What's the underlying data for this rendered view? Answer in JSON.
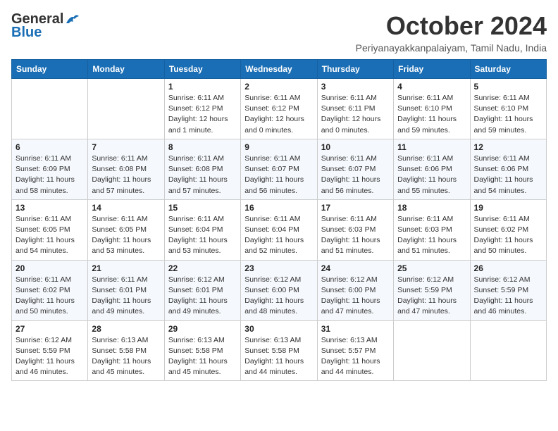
{
  "logo": {
    "line1": "General",
    "line2": "Blue"
  },
  "title": "October 2024",
  "location": "Periyanayakkanpalaiyam, Tamil Nadu, India",
  "days_of_week": [
    "Sunday",
    "Monday",
    "Tuesday",
    "Wednesday",
    "Thursday",
    "Friday",
    "Saturday"
  ],
  "weeks": [
    [
      {
        "day": "",
        "info": ""
      },
      {
        "day": "",
        "info": ""
      },
      {
        "day": "1",
        "info": "Sunrise: 6:11 AM\nSunset: 6:12 PM\nDaylight: 12 hours\nand 1 minute."
      },
      {
        "day": "2",
        "info": "Sunrise: 6:11 AM\nSunset: 6:12 PM\nDaylight: 12 hours\nand 0 minutes."
      },
      {
        "day": "3",
        "info": "Sunrise: 6:11 AM\nSunset: 6:11 PM\nDaylight: 12 hours\nand 0 minutes."
      },
      {
        "day": "4",
        "info": "Sunrise: 6:11 AM\nSunset: 6:10 PM\nDaylight: 11 hours\nand 59 minutes."
      },
      {
        "day": "5",
        "info": "Sunrise: 6:11 AM\nSunset: 6:10 PM\nDaylight: 11 hours\nand 59 minutes."
      }
    ],
    [
      {
        "day": "6",
        "info": "Sunrise: 6:11 AM\nSunset: 6:09 PM\nDaylight: 11 hours\nand 58 minutes."
      },
      {
        "day": "7",
        "info": "Sunrise: 6:11 AM\nSunset: 6:08 PM\nDaylight: 11 hours\nand 57 minutes."
      },
      {
        "day": "8",
        "info": "Sunrise: 6:11 AM\nSunset: 6:08 PM\nDaylight: 11 hours\nand 57 minutes."
      },
      {
        "day": "9",
        "info": "Sunrise: 6:11 AM\nSunset: 6:07 PM\nDaylight: 11 hours\nand 56 minutes."
      },
      {
        "day": "10",
        "info": "Sunrise: 6:11 AM\nSunset: 6:07 PM\nDaylight: 11 hours\nand 56 minutes."
      },
      {
        "day": "11",
        "info": "Sunrise: 6:11 AM\nSunset: 6:06 PM\nDaylight: 11 hours\nand 55 minutes."
      },
      {
        "day": "12",
        "info": "Sunrise: 6:11 AM\nSunset: 6:06 PM\nDaylight: 11 hours\nand 54 minutes."
      }
    ],
    [
      {
        "day": "13",
        "info": "Sunrise: 6:11 AM\nSunset: 6:05 PM\nDaylight: 11 hours\nand 54 minutes."
      },
      {
        "day": "14",
        "info": "Sunrise: 6:11 AM\nSunset: 6:05 PM\nDaylight: 11 hours\nand 53 minutes."
      },
      {
        "day": "15",
        "info": "Sunrise: 6:11 AM\nSunset: 6:04 PM\nDaylight: 11 hours\nand 53 minutes."
      },
      {
        "day": "16",
        "info": "Sunrise: 6:11 AM\nSunset: 6:04 PM\nDaylight: 11 hours\nand 52 minutes."
      },
      {
        "day": "17",
        "info": "Sunrise: 6:11 AM\nSunset: 6:03 PM\nDaylight: 11 hours\nand 51 minutes."
      },
      {
        "day": "18",
        "info": "Sunrise: 6:11 AM\nSunset: 6:03 PM\nDaylight: 11 hours\nand 51 minutes."
      },
      {
        "day": "19",
        "info": "Sunrise: 6:11 AM\nSunset: 6:02 PM\nDaylight: 11 hours\nand 50 minutes."
      }
    ],
    [
      {
        "day": "20",
        "info": "Sunrise: 6:11 AM\nSunset: 6:02 PM\nDaylight: 11 hours\nand 50 minutes."
      },
      {
        "day": "21",
        "info": "Sunrise: 6:11 AM\nSunset: 6:01 PM\nDaylight: 11 hours\nand 49 minutes."
      },
      {
        "day": "22",
        "info": "Sunrise: 6:12 AM\nSunset: 6:01 PM\nDaylight: 11 hours\nand 49 minutes."
      },
      {
        "day": "23",
        "info": "Sunrise: 6:12 AM\nSunset: 6:00 PM\nDaylight: 11 hours\nand 48 minutes."
      },
      {
        "day": "24",
        "info": "Sunrise: 6:12 AM\nSunset: 6:00 PM\nDaylight: 11 hours\nand 47 minutes."
      },
      {
        "day": "25",
        "info": "Sunrise: 6:12 AM\nSunset: 5:59 PM\nDaylight: 11 hours\nand 47 minutes."
      },
      {
        "day": "26",
        "info": "Sunrise: 6:12 AM\nSunset: 5:59 PM\nDaylight: 11 hours\nand 46 minutes."
      }
    ],
    [
      {
        "day": "27",
        "info": "Sunrise: 6:12 AM\nSunset: 5:59 PM\nDaylight: 11 hours\nand 46 minutes."
      },
      {
        "day": "28",
        "info": "Sunrise: 6:13 AM\nSunset: 5:58 PM\nDaylight: 11 hours\nand 45 minutes."
      },
      {
        "day": "29",
        "info": "Sunrise: 6:13 AM\nSunset: 5:58 PM\nDaylight: 11 hours\nand 45 minutes."
      },
      {
        "day": "30",
        "info": "Sunrise: 6:13 AM\nSunset: 5:58 PM\nDaylight: 11 hours\nand 44 minutes."
      },
      {
        "day": "31",
        "info": "Sunrise: 6:13 AM\nSunset: 5:57 PM\nDaylight: 11 hours\nand 44 minutes."
      },
      {
        "day": "",
        "info": ""
      },
      {
        "day": "",
        "info": ""
      }
    ]
  ]
}
